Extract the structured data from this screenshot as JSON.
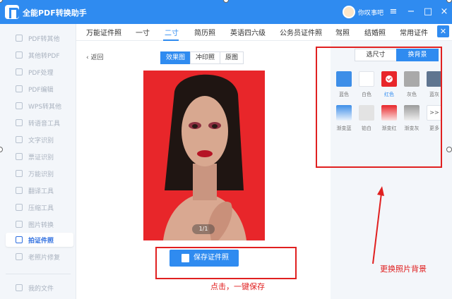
{
  "app": {
    "title": "全能PDF转换助手",
    "username": "你叹事吧"
  },
  "window_buttons": [
    "≡",
    "−",
    "□",
    "×"
  ],
  "sidebar": {
    "items": [
      {
        "label": "PDF转其他",
        "icon": "pdf-convert-icon"
      },
      {
        "label": "其他转PDF",
        "icon": "to-pdf-icon"
      },
      {
        "label": "PDF处理",
        "icon": "pdf-process-icon"
      },
      {
        "label": "PDF编辑",
        "icon": "pdf-edit-icon"
      },
      {
        "label": "WPS转其他",
        "icon": "wps-icon"
      },
      {
        "label": "转语音工具",
        "icon": "voice-icon"
      },
      {
        "label": "文字识别",
        "icon": "ocr-icon"
      },
      {
        "label": "票证识别",
        "icon": "ticket-icon"
      },
      {
        "label": "万能识别",
        "icon": "scan-icon"
      },
      {
        "label": "翻译工具",
        "icon": "translate-icon"
      },
      {
        "label": "压缩工具",
        "icon": "compress-icon"
      },
      {
        "label": "图片转换",
        "icon": "image-icon"
      },
      {
        "label": "拍证件照",
        "icon": "id-photo-icon",
        "active": true
      },
      {
        "label": "老照片修复",
        "icon": "restore-icon"
      }
    ],
    "my_files": "我的文件"
  },
  "tabs": [
    "万能证件照",
    "一寸",
    "二寸",
    "简历照",
    "英语四六级",
    "公务员证件照",
    "驾照",
    "结婚照",
    "常用证件"
  ],
  "active_tab": "二寸",
  "content": {
    "back_label": "返回",
    "view_modes": [
      "效果图",
      "冲印照",
      "原图"
    ],
    "active_view": "效果图",
    "page_indicator": "1/1",
    "save_button": "保存证件照"
  },
  "panel": {
    "modes": [
      "选尺寸",
      "换背景"
    ],
    "active_mode": "换背景",
    "swatches": [
      {
        "label": "蓝色",
        "color": "#3d8ee8"
      },
      {
        "label": "白色",
        "color": "#ffffff"
      },
      {
        "label": "红色",
        "color": "#e8262a",
        "selected": true
      },
      {
        "label": "灰色",
        "color": "#a9a9a9"
      },
      {
        "label": "蓝灰",
        "color": "#5f7590"
      },
      {
        "label": "渐变蓝",
        "gradient": [
          "#3d8ee8",
          "#eaf2fc"
        ]
      },
      {
        "label": "铂白",
        "color": "#e3e3e3"
      },
      {
        "label": "渐变红",
        "gradient": [
          "#e8262a",
          "#fbe1e1"
        ]
      },
      {
        "label": "渐变灰",
        "gradient": [
          "#9a9a9a",
          "#efefef"
        ]
      },
      {
        "label": "更多",
        "more": ">>"
      }
    ]
  },
  "annotations": {
    "save_note": "点击，一键保存",
    "bg_note": "更换照片背景"
  },
  "colors": {
    "accent": "#2f8bf0",
    "annotation": "#e02020"
  }
}
